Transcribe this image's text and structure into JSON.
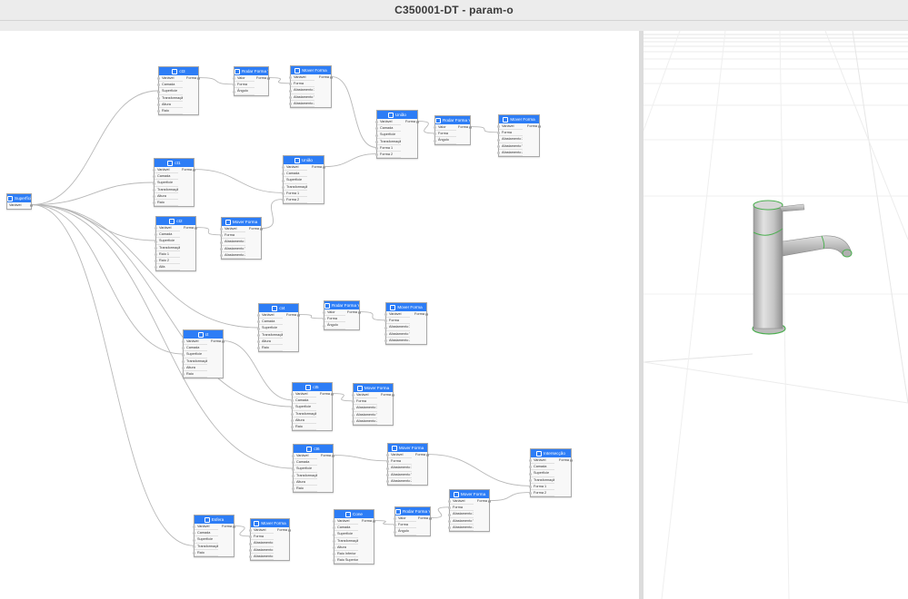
{
  "window": {
    "title": "C350001-DT - param-o"
  },
  "nodes": [
    {
      "id": "sup",
      "title": "Superfície",
      "icon": "surface-icon",
      "inputs": [],
      "output": "Variável",
      "outputRow": true
    },
    {
      "id": "n_ct3",
      "title": "ct3",
      "icon": "cylinder-icon",
      "inputs": [
        "Variável",
        "Camada",
        "Superfície",
        "Transformação",
        "Altura",
        "Raio"
      ],
      "output": "Forma"
    },
    {
      "id": "n_rod1",
      "title": "Rodar Forma Y",
      "icon": "rotate-icon",
      "inputs": [
        "Valor",
        "Forma",
        "Ângulo"
      ],
      "output": "Forma"
    },
    {
      "id": "n_mov1",
      "title": "Mover Forma",
      "icon": "move-icon",
      "inputs": [
        "Variável",
        "Forma",
        "Afastamento X",
        "Afastamento Y",
        "Afastamento Z"
      ],
      "output": "Forma"
    },
    {
      "id": "n_un2",
      "title": "União",
      "icon": "union-icon",
      "inputs": [
        "Variável",
        "Camada",
        "Superfície",
        "Transformação",
        "Forma 1",
        "Forma 2"
      ],
      "output": "Forma"
    },
    {
      "id": "n_rod2",
      "title": "Rodar Forma Y",
      "icon": "rotate-icon",
      "inputs": [
        "Valor",
        "Forma",
        "Ângulo"
      ],
      "output": "Forma"
    },
    {
      "id": "n_mov2",
      "title": "Mover Forma",
      "icon": "move-icon",
      "inputs": [
        "Variável",
        "Forma",
        "Afastamento X",
        "Afastamento Y",
        "Afastamento Z"
      ],
      "output": "Forma"
    },
    {
      "id": "n_ct1",
      "title": "ct1",
      "icon": "cylinder-icon",
      "inputs": [
        "Variável",
        "Camada",
        "Superfície",
        "Transformação",
        "Altura",
        "Raio"
      ],
      "output": "Forma"
    },
    {
      "id": "n_un1",
      "title": "União",
      "icon": "union-icon",
      "inputs": [
        "Variável",
        "Camada",
        "Superfície",
        "Transformação",
        "Forma 1",
        "Forma 2"
      ],
      "output": "Forma"
    },
    {
      "id": "n_ct2",
      "title": "ct2",
      "icon": "cylinder-icon",
      "inputs": [
        "Variável",
        "Camada",
        "Superfície",
        "Transformação",
        "Raio 1",
        "Raio 2",
        "Alfa"
      ],
      "output": "Forma"
    },
    {
      "id": "n_mov3",
      "title": "Mover Forma",
      "icon": "move-icon",
      "inputs": [
        "Variável",
        "Forma",
        "Afastamento X",
        "Afastamento Y",
        "Afastamento Z"
      ],
      "output": "Forma"
    },
    {
      "id": "n_ct4",
      "title": "ct4",
      "icon": "cylinder-icon",
      "inputs": [
        "Variável",
        "Camada",
        "Superfície",
        "Transformação",
        "Altura",
        "Raio"
      ],
      "output": "Forma"
    },
    {
      "id": "n_rod3",
      "title": "Rodar Forma Y",
      "icon": "rotate-icon",
      "inputs": [
        "Valor",
        "Forma",
        "Ângulo"
      ],
      "output": "Forma"
    },
    {
      "id": "n_mov4",
      "title": "Mover Forma",
      "icon": "move-icon",
      "inputs": [
        "Variável",
        "Forma",
        "Afastamento X",
        "Afastamento Y",
        "Afastamento Z"
      ],
      "output": "Forma"
    },
    {
      "id": "n_ct",
      "title": "ct",
      "icon": "cylinder-icon",
      "inputs": [
        "Variável",
        "Camada",
        "Superfície",
        "Transformação",
        "Altura",
        "Raio"
      ],
      "output": "Forma"
    },
    {
      "id": "n_ct5",
      "title": "ct5",
      "icon": "cylinder-icon",
      "inputs": [
        "Variável",
        "Camada",
        "Superfície",
        "Transformação",
        "Altura",
        "Raio"
      ],
      "output": "Forma"
    },
    {
      "id": "n_mov5",
      "title": "Mover Forma",
      "icon": "move-icon",
      "inputs": [
        "Variável",
        "Forma",
        "Afastamento X",
        "Afastamento Y",
        "Afastamento Z"
      ],
      "output": "Forma"
    },
    {
      "id": "n_ct6",
      "title": "ct6",
      "icon": "cylinder-icon",
      "inputs": [
        "Variável",
        "Camada",
        "Superfície",
        "Transformação",
        "Altura",
        "Raio"
      ],
      "output": "Forma"
    },
    {
      "id": "n_mov6",
      "title": "Mover Forma",
      "icon": "move-icon",
      "inputs": [
        "Variável",
        "Forma",
        "Afastamento X",
        "Afastamento Y",
        "Afastamento Z"
      ],
      "output": "Forma"
    },
    {
      "id": "n_int",
      "title": "Intersecção",
      "icon": "intersect-icon",
      "inputs": [
        "Variável",
        "Camada",
        "Superfície",
        "Transformação",
        "Forma 1",
        "Forma 2"
      ],
      "output": "Forma"
    },
    {
      "id": "n_esf",
      "title": "Esfera",
      "icon": "sphere-icon",
      "inputs": [
        "Variável",
        "Camada",
        "Superfície",
        "Transformação",
        "Raio"
      ],
      "output": "Forma"
    },
    {
      "id": "n_mov7",
      "title": "Mover Forma",
      "icon": "move-icon",
      "inputs": [
        "Variável",
        "Forma",
        "Afastamento X",
        "Afastamento Y",
        "Afastamento Z"
      ],
      "output": "Forma"
    },
    {
      "id": "n_cone",
      "title": "Cone",
      "icon": "cone-icon",
      "inputs": [
        "Variável",
        "Camada",
        "Superfície",
        "Transformação",
        "Altura",
        "Raio Inferior",
        "Raio Superior"
      ],
      "output": "Forma"
    },
    {
      "id": "n_rod4",
      "title": "Rodar Forma Y",
      "icon": "rotate-icon",
      "inputs": [
        "Valor",
        "Forma",
        "Ângulo"
      ],
      "output": "Forma"
    },
    {
      "id": "n_mov8",
      "title": "Mover Forma",
      "icon": "move-icon",
      "inputs": [
        "Variável",
        "Forma",
        "Afastamento X",
        "Afastamento Y",
        "Afastamento Z"
      ],
      "output": "Forma"
    }
  ],
  "links": [
    [
      "sup",
      "n_ct3",
      2
    ],
    [
      "sup",
      "n_ct1",
      2
    ],
    [
      "sup",
      "n_ct2",
      2
    ],
    [
      "sup",
      "n_ct4",
      2
    ],
    [
      "sup",
      "n_ct",
      2
    ],
    [
      "sup",
      "n_ct5",
      2
    ],
    [
      "sup",
      "n_ct6",
      2
    ],
    [
      "sup",
      "n_esf",
      3
    ],
    [
      "n_ct3",
      "n_rod1",
      1
    ],
    [
      "n_rod1",
      "n_mov1",
      1
    ],
    [
      "n_mov1",
      "n_un2",
      4
    ],
    [
      "n_un2",
      "n_rod2",
      1
    ],
    [
      "n_rod2",
      "n_mov2",
      1
    ],
    [
      "n_ct1",
      "n_un1",
      4
    ],
    [
      "n_ct2",
      "n_mov3",
      1
    ],
    [
      "n_mov3",
      "n_un1",
      5
    ],
    [
      "n_un1",
      "n_un2",
      5
    ],
    [
      "n_ct4",
      "n_rod3",
      1
    ],
    [
      "n_rod3",
      "n_mov4",
      1
    ],
    [
      "n_ct",
      "n_ct5",
      1
    ],
    [
      "n_ct5",
      "n_mov5",
      1
    ],
    [
      "n_ct6",
      "n_mov6",
      1
    ],
    [
      "n_mov6",
      "n_int",
      4
    ],
    [
      "n_mov8",
      "n_int",
      5
    ],
    [
      "n_esf",
      "n_mov7",
      1
    ],
    [
      "n_cone",
      "n_rod4",
      1
    ],
    [
      "n_rod4",
      "n_mov8",
      1
    ]
  ],
  "colors": {
    "node_header": "#2d7df6",
    "wire": "#b8b8b8",
    "model_body": "#c9c9c9",
    "model_edge": "#4caf50"
  }
}
